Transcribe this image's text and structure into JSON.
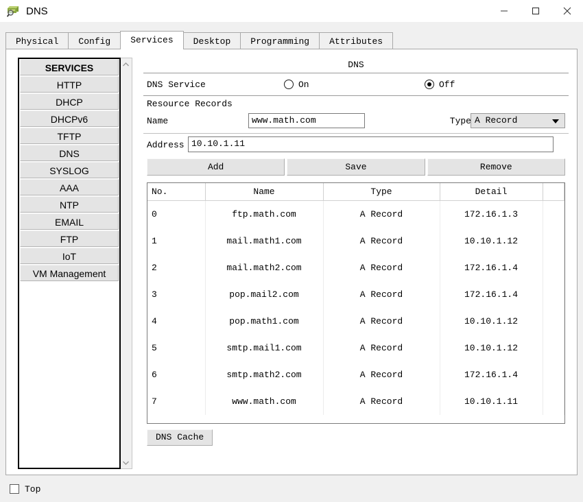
{
  "window": {
    "title": "DNS",
    "icon": "dns-server-icon",
    "controls": {
      "minimize": "minimize-icon",
      "maximize": "maximize-icon",
      "close": "close-icon"
    }
  },
  "tabs": [
    {
      "label": "Physical",
      "active": false
    },
    {
      "label": "Config",
      "active": false
    },
    {
      "label": "Services",
      "active": true
    },
    {
      "label": "Desktop",
      "active": false
    },
    {
      "label": "Programming",
      "active": false
    },
    {
      "label": "Attributes",
      "active": false
    }
  ],
  "sidebar": {
    "header": "SERVICES",
    "items": [
      {
        "label": "HTTP"
      },
      {
        "label": "DHCP"
      },
      {
        "label": "DHCPv6"
      },
      {
        "label": "TFTP"
      },
      {
        "label": "DNS"
      },
      {
        "label": "SYSLOG"
      },
      {
        "label": "AAA"
      },
      {
        "label": "NTP"
      },
      {
        "label": "EMAIL"
      },
      {
        "label": "FTP"
      },
      {
        "label": "IoT"
      },
      {
        "label": "VM Management"
      }
    ],
    "scroll": {
      "up": "chevron-up-icon",
      "down": "chevron-down-icon"
    }
  },
  "main": {
    "panel_title": "DNS",
    "service": {
      "label": "DNS Service",
      "on_label": "On",
      "off_label": "Off",
      "selected": "Off"
    },
    "resource_records": {
      "section_label": "Resource Records",
      "name_label": "Name",
      "name_value": "www.math.com",
      "type_label": "Type",
      "type_value": "A Record",
      "address_label": "Address",
      "address_value": "10.10.1.11"
    },
    "buttons": {
      "add": "Add",
      "save": "Save",
      "remove": "Remove",
      "dns_cache": "DNS Cache"
    },
    "table": {
      "columns": [
        "No.",
        "Name",
        "Type",
        "Detail"
      ],
      "rows": [
        {
          "no": "0",
          "name": "ftp.math.com",
          "type": "A Record",
          "detail": "172.16.1.3"
        },
        {
          "no": "1",
          "name": "mail.math1.com",
          "type": "A Record",
          "detail": "10.10.1.12"
        },
        {
          "no": "2",
          "name": "mail.math2.com",
          "type": "A Record",
          "detail": "172.16.1.4"
        },
        {
          "no": "3",
          "name": "pop.mail2.com",
          "type": "A Record",
          "detail": "172.16.1.4"
        },
        {
          "no": "4",
          "name": "pop.math1.com",
          "type": "A Record",
          "detail": "10.10.1.12"
        },
        {
          "no": "5",
          "name": "smtp.mail1.com",
          "type": "A Record",
          "detail": "10.10.1.12"
        },
        {
          "no": "6",
          "name": "smtp.math2.com",
          "type": "A Record",
          "detail": "172.16.1.4"
        },
        {
          "no": "7",
          "name": "www.math.com",
          "type": "A Record",
          "detail": "10.10.1.11"
        }
      ]
    }
  },
  "footer": {
    "top_label": "Top",
    "top_checked": false
  },
  "colors": {
    "window_bg": "#f0f0f0",
    "panel_bg": "#ffffff",
    "button_face": "#e4e4e4",
    "border": "#a8a8a8"
  }
}
